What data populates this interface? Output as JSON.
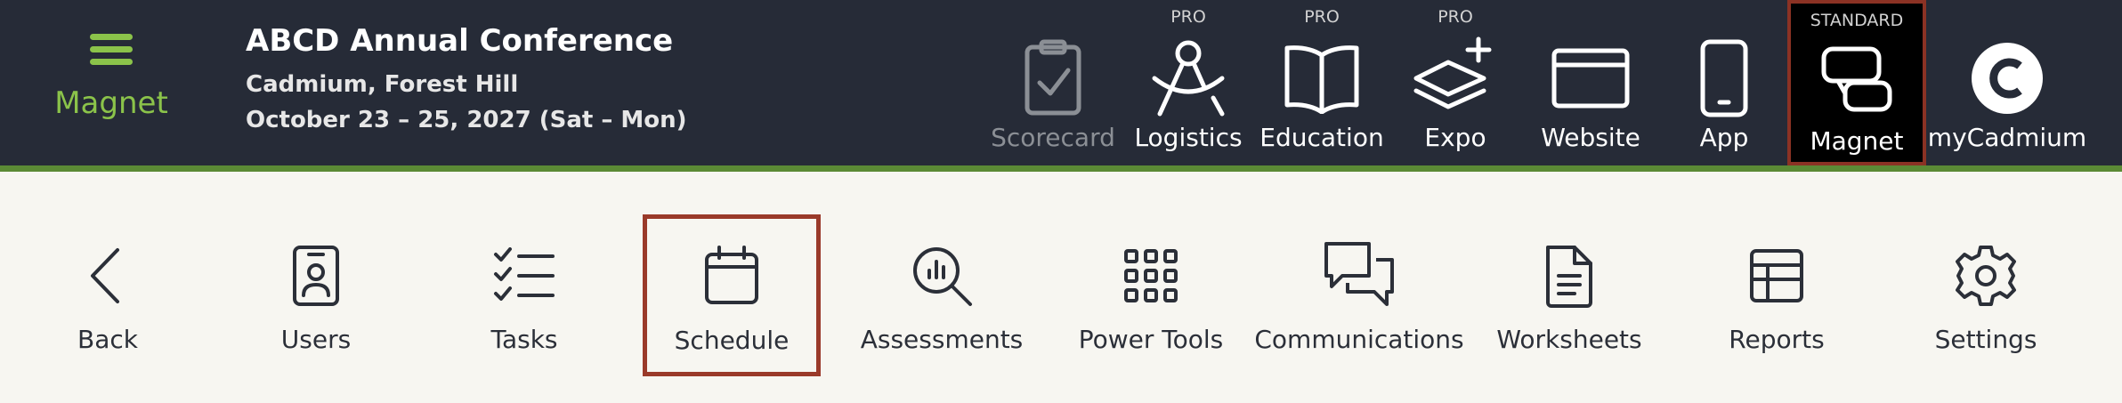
{
  "brand": {
    "label": "Magnet",
    "icon": "hamburger-menu-icon",
    "color": "#8bc34a"
  },
  "event": {
    "title": "ABCD Annual Conference",
    "location": "Cadmium, Forest Hill",
    "dates": "October 23 – 25, 2027 (Sat – Mon)"
  },
  "top_nav": [
    {
      "label": "Scorecard",
      "badge": "",
      "icon": "clipboard-check-icon",
      "state": "disabled"
    },
    {
      "label": "Logistics",
      "badge": "PRO",
      "icon": "compass-icon",
      "state": "normal"
    },
    {
      "label": "Education",
      "badge": "PRO",
      "icon": "book-open-icon",
      "state": "normal"
    },
    {
      "label": "Expo",
      "badge": "PRO",
      "icon": "layers-plus-icon",
      "state": "normal"
    },
    {
      "label": "Website",
      "badge": "",
      "icon": "browser-window-icon",
      "state": "normal"
    },
    {
      "label": "App",
      "badge": "",
      "icon": "mobile-phone-icon",
      "state": "normal"
    },
    {
      "label": "Magnet",
      "badge": "STANDARD",
      "icon": "magnet-app-icon",
      "state": "active"
    },
    {
      "label": "myCadmium",
      "badge": "",
      "icon": "cadmium-logo-icon",
      "state": "normal"
    }
  ],
  "sub_nav": [
    {
      "label": "Back",
      "icon": "chevron-left-icon"
    },
    {
      "label": "Users",
      "icon": "id-badge-icon"
    },
    {
      "label": "Tasks",
      "icon": "checklist-icon"
    },
    {
      "label": "Schedule",
      "icon": "calendar-icon",
      "active": true
    },
    {
      "label": "Assessments",
      "icon": "magnifier-chart-icon"
    },
    {
      "label": "Power Tools",
      "icon": "grid-dots-icon"
    },
    {
      "label": "Communications",
      "icon": "chat-bubbles-icon"
    },
    {
      "label": "Worksheets",
      "icon": "document-icon"
    },
    {
      "label": "Reports",
      "icon": "table-icon"
    },
    {
      "label": "Settings",
      "icon": "gear-icon"
    }
  ],
  "colors": {
    "topbar": "#262b37",
    "accent_line": "#5b8a35",
    "active_border": "#9a3a2a"
  }
}
